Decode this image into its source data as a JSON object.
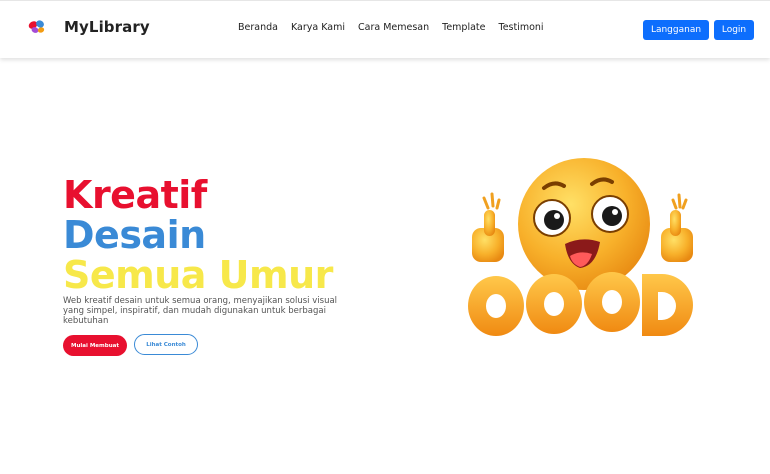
{
  "navbar": {
    "brand": "MyLibrary",
    "logo_icon": "butterfly-logo-icon",
    "links": [
      {
        "label": "Beranda"
      },
      {
        "label": "Karya Kami"
      },
      {
        "label": "Cara Memesan"
      },
      {
        "label": "Template"
      },
      {
        "label": "Testimoni"
      }
    ],
    "subscribe_label": "Langganan",
    "login_label": "Login"
  },
  "hero": {
    "line1": "Kreatif",
    "line2": "Desain",
    "line3": "Semua Umur",
    "description": "Web kreatif desain untuk semua orang, menyajikan solusi visual yang simpel, inspiratif, dan mudah digunakan untuk berbagai kebutuhan",
    "primary_button": "Mulai Membuat",
    "secondary_button": "Lihat Contoh",
    "illustration_icon": "thumbs-up-emoji-good-illustration"
  },
  "colors": {
    "accent_red": "#e8102f",
    "accent_blue": "#3a8ad6",
    "accent_yellow": "#f7e84a",
    "button_blue": "#0d6efd"
  }
}
